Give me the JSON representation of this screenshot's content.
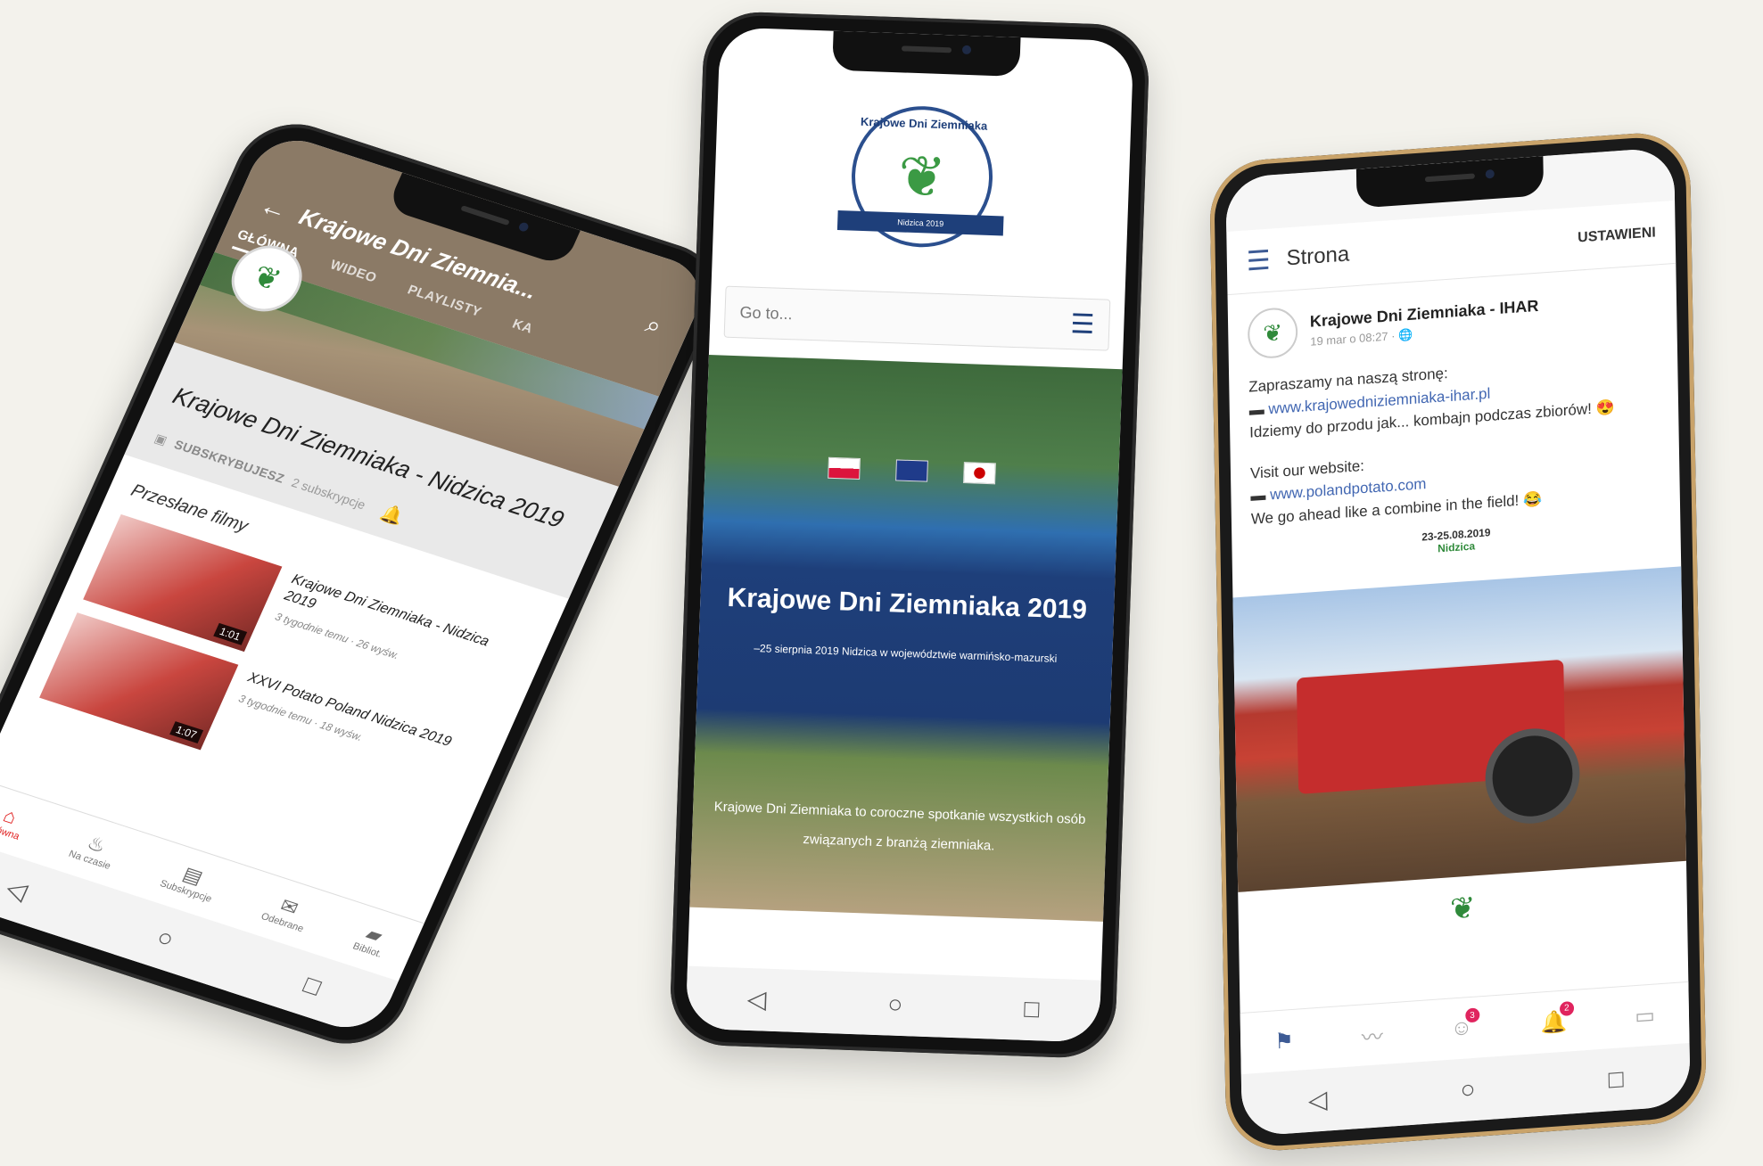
{
  "youtube": {
    "channel_header": "Krajowe Dni Ziemnia...",
    "tabs": [
      "GŁÓWNA",
      "WIDEO",
      "PLAYLISTY",
      "KA"
    ],
    "channel_name": "Krajowe Dni Ziemniaka - Nidzica 2019",
    "subscribe_label": "SUBSKRYBUJESZ",
    "subscribers": "2 subskrypcje",
    "section_title": "Przesłane filmy",
    "videos": [
      {
        "title": "Krajowe Dni Ziemniaka - Nidzica 2019",
        "meta": "3 tygodnie temu · 26 wyśw.",
        "duration": "1:01"
      },
      {
        "title": "XXVI Potato Poland Nidzica 2019",
        "meta": "3 tygodnie temu · 18 wyśw.",
        "duration": "1:07"
      }
    ],
    "bottom_nav": [
      "Główna",
      "Na czasie",
      "Subskrypcje",
      "Odebrane",
      "Bibliot."
    ]
  },
  "website": {
    "search_placeholder": "Go to...",
    "logo_text": "Krajowe Dni Ziemniaka",
    "logo_ribbon": "Nidzica 2019",
    "hero_title": "Krajowe Dni Ziemniaka 2019",
    "hero_subtitle": "–25 sierpnia 2019 Nidzica w województwie warmińsko-mazurski",
    "hero_text": "Krajowe Dni Ziemniaka to coroczne spotkanie wszystkich osób związanych z branżą ziemniaka."
  },
  "facebook": {
    "header_title": "Strona",
    "settings": "USTAWIENI",
    "author": "Krajowe Dni Ziemniaka - IHAR",
    "date": "19 mar o 08:27 · 🌐",
    "line1": "Zapraszamy na naszą stronę:",
    "link_pl": "www.krajowedniziemniaka-ihar.pl",
    "line2": "Idziemy do przodu jak... kombajn podczas zbiorów! 😍",
    "line3": "Visit our website:",
    "link_en": "www.polandpotato.com",
    "line4": "We go ahead like a combine in the field! 😂",
    "event_date": "23-25.08.2019",
    "event_place": "Nidzica",
    "badges": [
      "3",
      "2"
    ]
  },
  "colors": {
    "youtube_header": "#8b7a66",
    "youtube_red": "#e02020",
    "site_navy": "#1e3f7a",
    "fb_blue": "#4267b2"
  }
}
